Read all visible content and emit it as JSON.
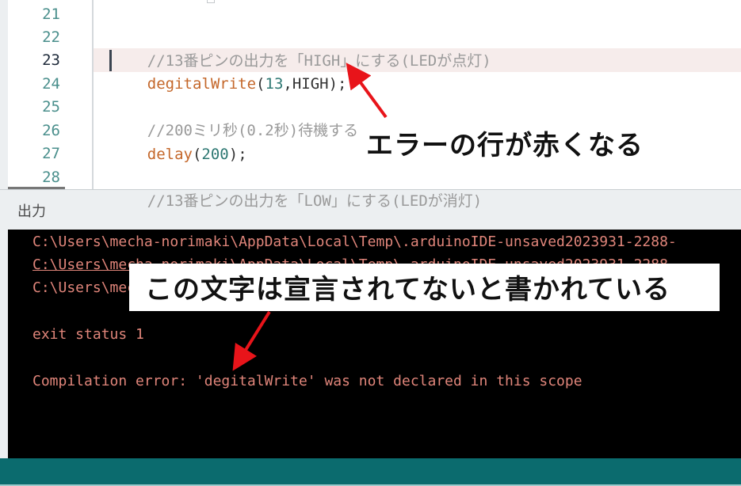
{
  "editor": {
    "lines": [
      {
        "number": "21",
        "segments": []
      },
      {
        "number": "22",
        "segments": [
          {
            "type": "comment",
            "text": "//13番ピンの出力を「HIGH」にする(LEDが点灯)"
          }
        ]
      },
      {
        "number": "23",
        "current": true,
        "error": true,
        "segments": [
          {
            "type": "fn",
            "text": "degitalWrite"
          },
          {
            "type": "plain",
            "text": "("
          },
          {
            "type": "num",
            "text": "13"
          },
          {
            "type": "plain",
            "text": ",HIGH);"
          }
        ]
      },
      {
        "number": "24",
        "segments": []
      },
      {
        "number": "25",
        "segments": [
          {
            "type": "comment",
            "text": "//200ミリ秒(0.2秒)待機する"
          }
        ]
      },
      {
        "number": "26",
        "segments": [
          {
            "type": "fn",
            "text": "delay"
          },
          {
            "type": "plain",
            "text": "("
          },
          {
            "type": "num",
            "text": "200"
          },
          {
            "type": "plain",
            "text": ");"
          }
        ]
      },
      {
        "number": "27",
        "segments": []
      },
      {
        "number": "28",
        "segments": [
          {
            "type": "comment",
            "text": "//13番ピンの出力を「LOW」にする(LEDが消灯)"
          }
        ]
      }
    ]
  },
  "output": {
    "title": "出力",
    "lines": [
      "C:\\Users\\mecha-norimaki\\AppData\\Local\\Temp\\.arduinoIDE-unsaved2023931-2288-",
      "C:\\Users\\mecha-norimaki\\AppData\\Local\\Temp\\.arduinoIDE-unsaved2023931-2288-",
      "C:\\Users\\mecha-norimaki\\AppData\\Local\\Temp\\.arduinoIDE-unsaved2023931-2288-",
      "",
      "exit status 1",
      "",
      "Compilation error: 'degitalWrite' was not declared in this scope"
    ]
  },
  "annotations": {
    "error_line_note": "エラーの行が赤くなる",
    "undeclared_note": "この文字は宣言されてないと書かれている",
    "arrow_color": "#e8141a"
  },
  "colors": {
    "statusbar": "#0b6b6e",
    "console_text": "#e0857a",
    "error_line_bg": "#f6eceb"
  }
}
